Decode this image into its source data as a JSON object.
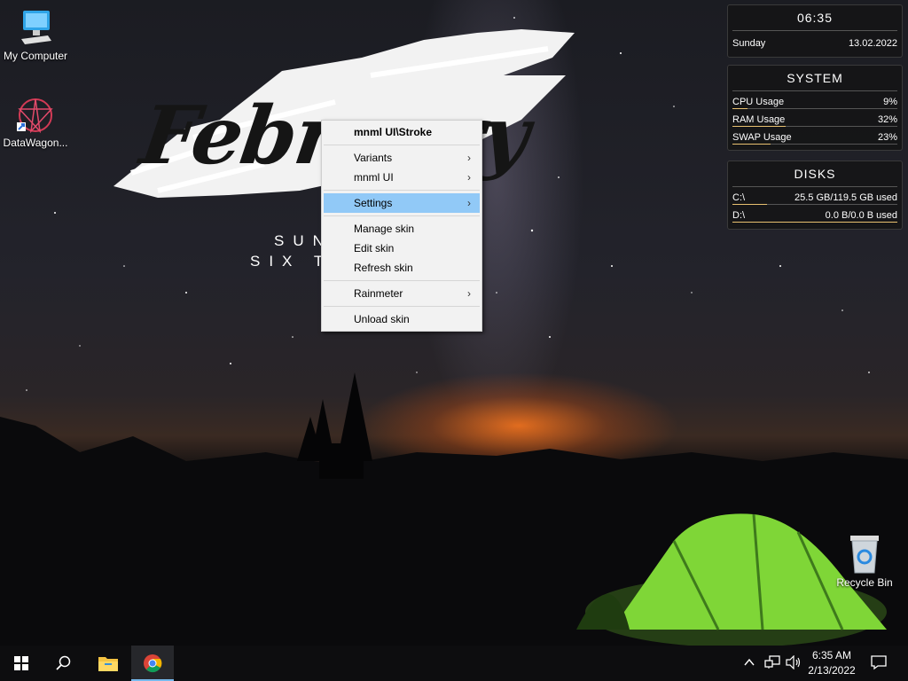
{
  "desktop": {
    "icons": [
      {
        "label": "My Computer"
      },
      {
        "label": "DataWagon..."
      },
      {
        "label": "Recycle Bin"
      }
    ],
    "wallpaper": {
      "word": "Febr",
      "word_end": "ry",
      "line1": "SUN",
      "line2": "SIX T"
    }
  },
  "widgets": {
    "clock": {
      "time": "06:35",
      "day": "Sunday",
      "date": "13.02.2022"
    },
    "system": {
      "title": "SYSTEM",
      "rows": [
        {
          "label": "CPU Usage",
          "value": "9%",
          "fill": 0.09
        },
        {
          "label": "RAM Usage",
          "value": "32%",
          "fill": 0.32
        },
        {
          "label": "SWAP Usage",
          "value": "23%",
          "fill": 0.23
        }
      ]
    },
    "disks": {
      "title": "DISKS",
      "rows": [
        {
          "label": "C:\\",
          "value": "25.5 GB/119.5 GB used",
          "fill": 0.21
        },
        {
          "label": "D:\\",
          "value": "0.0 B/0.0 B used",
          "fill": 1.0
        }
      ]
    }
  },
  "context_menu": {
    "header": "mnml UI\\Stroke",
    "items": {
      "variants": "Variants",
      "mnml_ui": "mnml UI",
      "settings": "Settings",
      "manage_skin": "Manage skin",
      "edit_skin": "Edit skin",
      "refresh_skin": "Refresh skin",
      "rainmeter": "Rainmeter",
      "unload_skin": "Unload skin"
    },
    "highlighted": "Settings"
  },
  "taskbar": {
    "time": "6:35 AM",
    "date": "2/13/2022"
  },
  "colors": {
    "menu_highlight": "#91c9f7",
    "widget_bar": "#e8c070",
    "taskbar": "#0d0d0f"
  }
}
